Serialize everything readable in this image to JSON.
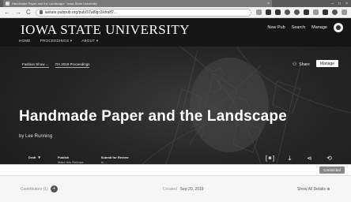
{
  "browser": {
    "tab_title": "Handmade Paper and the Landscape · Iowa State University",
    "tab_close": "×",
    "window_controls": [
      "–",
      "□",
      "×"
    ],
    "nav": {
      "back": "←",
      "forward": "→",
      "reload": "C"
    },
    "url": "iastate.pubpub.org/pub/57a8lgc3/draft?..."
  },
  "site": {
    "logo": "IOWA STATE UNIVERSITY",
    "topnav": {
      "new_pub": "New Pub",
      "search": "Search",
      "manage": "Manage"
    },
    "subnav": [
      "HOME",
      "PROCEEDINGS ▾",
      "ABOUT ▾"
    ]
  },
  "pub": {
    "tags": [
      "Fashion Show ...",
      "ITA 2019 Proceedings"
    ],
    "share_label": "Share",
    "manage_label": "Manage",
    "title": "Handmade Paper and the Landscape",
    "byline": "by Lee Running",
    "meta": [
      {
        "key": "Draft",
        "value": "",
        "caret": "▾"
      },
      {
        "key": "Publish",
        "value": "Make this Release",
        "caret": ""
      },
      {
        "key": "Submit for Review",
        "value": "to ...",
        "caret": ""
      }
    ],
    "actions": {
      "cite": "[⁕]",
      "download": "⤓",
      "share": "⋖",
      "history": "⟲"
    },
    "connection_status": "Connected"
  },
  "info": {
    "contributors_label": "Contributors (1)",
    "add_contributor": "+",
    "created_label": "Created",
    "created_date": "Sep 20, 2019",
    "details_label": "Show All Details ⊕"
  }
}
